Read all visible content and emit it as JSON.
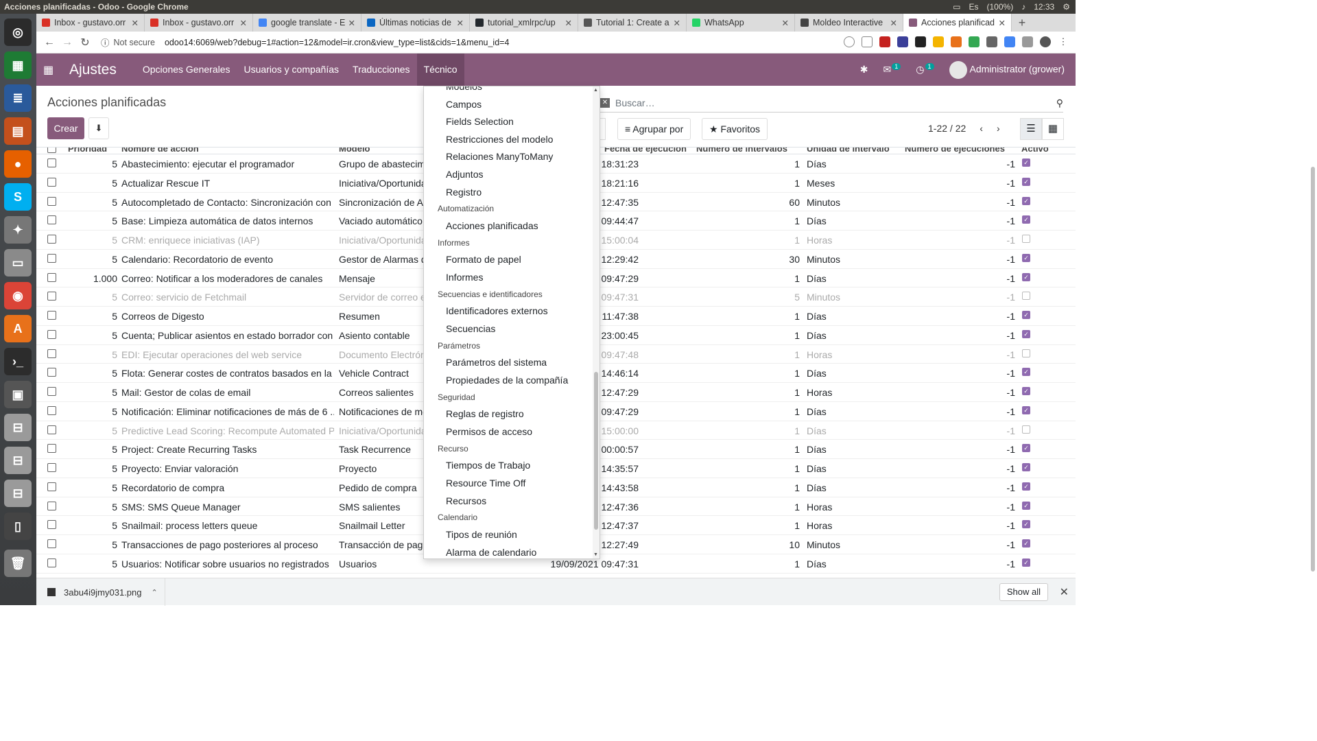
{
  "os": {
    "window_title": "Acciones planificadas - Odoo - Google Chrome",
    "battery": "(100%)",
    "time": "12:33",
    "kbd": "Es"
  },
  "chrome": {
    "tabs": [
      {
        "label": "Inbox - gustavo.orr",
        "color": "#d93025",
        "active": false
      },
      {
        "label": "Inbox - gustavo.orr",
        "color": "#d93025",
        "active": false
      },
      {
        "label": "google translate - E",
        "color": "#4285f4",
        "active": false
      },
      {
        "label": "Últimas noticias de",
        "color": "#0a66c2",
        "active": false
      },
      {
        "label": "tutorial_xmlrpc/up",
        "color": "#24292e",
        "active": false
      },
      {
        "label": "Tutorial 1: Create a",
        "color": "#555555",
        "active": false
      },
      {
        "label": "WhatsApp",
        "color": "#25d366",
        "active": false
      },
      {
        "label": "Moldeo Interactive",
        "color": "#444444",
        "active": false
      },
      {
        "label": "Acciones planificad",
        "color": "#875a7b",
        "active": true
      }
    ],
    "new_tab": "+",
    "not_secure": "Not secure",
    "url": "odoo14:6069/web?debug=1#action=12&model=ir.cron&view_type=list&cids=1&menu_id=4"
  },
  "odoo": {
    "brand": "Ajustes",
    "menus": [
      "Opciones Generales",
      "Usuarios y compañías",
      "Traducciones",
      "Técnico"
    ],
    "chat_badge": "1",
    "activity_badge": "1",
    "user": "Administrator (grower)",
    "title": "Acciones planificadas",
    "create": "Crear",
    "search_placeholder": "Buscar…",
    "group_by": "Agrupar por",
    "favorites": "Favoritos",
    "pager": "1-22 / 22",
    "accent": "#875a7b"
  },
  "table": {
    "headers": [
      "Prioridad",
      "Nombre de acción",
      "Modelo",
      "Fecha de ejecución",
      "Número de intervalos",
      "Unidad de intervalo",
      "Número de ejecuciones",
      "Activo"
    ],
    "rows": [
      {
        "prio": "5",
        "name": "Abastecimiento: ejecutar el programador",
        "model": "Grupo de abastecimi",
        "date": "18:31:23",
        "num": "1",
        "unit": "Días",
        "calls": "-1",
        "active": true
      },
      {
        "prio": "5",
        "name": "Actualizar Rescue IT",
        "model": "Iniciativa/Oportunidad",
        "date": "18:21:16",
        "num": "1",
        "unit": "Meses",
        "calls": "-1",
        "active": true
      },
      {
        "prio": "5",
        "name": "Autocompletado de Contacto: Sincronización con ...",
        "model": "Sincronización de Au",
        "date": "12:47:35",
        "num": "60",
        "unit": "Minutos",
        "calls": "-1",
        "active": true
      },
      {
        "prio": "5",
        "name": "Base: Limpieza automática de datos internos",
        "model": "Vaciado automático",
        "date": "09:44:47",
        "num": "1",
        "unit": "Días",
        "calls": "-1",
        "active": true
      },
      {
        "prio": "5",
        "name": "CRM: enriquece iniciativas (IAP)",
        "model": "Iniciativa/Oportunidad",
        "date": "15:00:04",
        "num": "1",
        "unit": "Horas",
        "calls": "-1",
        "active": false
      },
      {
        "prio": "5",
        "name": "Calendario: Recordatorio de evento",
        "model": "Gestor de Alarmas de",
        "date": "12:29:42",
        "num": "30",
        "unit": "Minutos",
        "calls": "-1",
        "active": true
      },
      {
        "prio": "1.000",
        "name": "Correo: Notificar a los moderadores de canales",
        "model": "Mensaje",
        "date": "09:47:29",
        "num": "1",
        "unit": "Días",
        "calls": "-1",
        "active": true
      },
      {
        "prio": "5",
        "name": "Correo: servicio de Fetchmail",
        "model": "Servidor de correo en",
        "date": "09:47:31",
        "num": "5",
        "unit": "Minutos",
        "calls": "-1",
        "active": false
      },
      {
        "prio": "5",
        "name": "Correos de Digesto",
        "model": "Resumen",
        "date": "11:47:38",
        "num": "1",
        "unit": "Días",
        "calls": "-1",
        "active": true
      },
      {
        "prio": "5",
        "name": "Cuenta; Publicar asientos en estado borrador con ...",
        "model": "Asiento contable",
        "date": "23:00:45",
        "num": "1",
        "unit": "Días",
        "calls": "-1",
        "active": true
      },
      {
        "prio": "5",
        "name": "EDI: Ejecutar operaciones del web service",
        "model": "Documento Electróni",
        "date": "09:47:48",
        "num": "1",
        "unit": "Horas",
        "calls": "-1",
        "active": false
      },
      {
        "prio": "5",
        "name": "Flota: Generar costes de contratos basados en la ...",
        "model": "Vehicle Contract",
        "date": "14:46:14",
        "num": "1",
        "unit": "Días",
        "calls": "-1",
        "active": true
      },
      {
        "prio": "5",
        "name": "Mail: Gestor de colas de email",
        "model": "Correos salientes",
        "date": "12:47:29",
        "num": "1",
        "unit": "Horas",
        "calls": "-1",
        "active": true
      },
      {
        "prio": "5",
        "name": "Notificación: Eliminar notificaciones de más de 6 ...",
        "model": "Notificaciones de me",
        "date": "09:47:29",
        "num": "1",
        "unit": "Días",
        "calls": "-1",
        "active": true
      },
      {
        "prio": "5",
        "name": "Predictive Lead Scoring: Recompute Automated P...",
        "model": "Iniciativa/Oportunidad",
        "date": "15:00:00",
        "num": "1",
        "unit": "Días",
        "calls": "-1",
        "active": false
      },
      {
        "prio": "5",
        "name": "Project: Create Recurring Tasks",
        "model": "Task Recurrence",
        "date": "00:00:57",
        "num": "1",
        "unit": "Días",
        "calls": "-1",
        "active": true
      },
      {
        "prio": "5",
        "name": "Proyecto: Enviar valoración",
        "model": "Proyecto",
        "date": "14:35:57",
        "num": "1",
        "unit": "Días",
        "calls": "-1",
        "active": true
      },
      {
        "prio": "5",
        "name": "Recordatorio de compra",
        "model": "Pedido de compra",
        "date": "14:43:58",
        "num": "1",
        "unit": "Días",
        "calls": "-1",
        "active": true
      },
      {
        "prio": "5",
        "name": "SMS: SMS Queue Manager",
        "model": "SMS salientes",
        "date": "12:47:36",
        "num": "1",
        "unit": "Horas",
        "calls": "-1",
        "active": true
      },
      {
        "prio": "5",
        "name": "Snailmail: process letters queue",
        "model": "Snailmail Letter",
        "date": "12:47:37",
        "num": "1",
        "unit": "Horas",
        "calls": "-1",
        "active": true
      },
      {
        "prio": "5",
        "name": "Transacciones de pago posteriores al proceso",
        "model": "Transacción de pago",
        "date": "12:27:49",
        "num": "10",
        "unit": "Minutos",
        "calls": "-1",
        "active": true
      },
      {
        "prio": "5",
        "name": "Usuarios: Notificar sobre usuarios no registrados",
        "model": "Usuarios",
        "date": "19/09/2021 09:47:31",
        "num": "1",
        "unit": "Días",
        "calls": "-1",
        "active": true
      }
    ]
  },
  "dropdown": [
    {
      "type": "item",
      "label": "Modelos"
    },
    {
      "type": "item",
      "label": "Campos"
    },
    {
      "type": "item",
      "label": "Fields Selection"
    },
    {
      "type": "item",
      "label": "Restricciones del modelo"
    },
    {
      "type": "item",
      "label": "Relaciones ManyToMany"
    },
    {
      "type": "item",
      "label": "Adjuntos"
    },
    {
      "type": "item",
      "label": "Registro"
    },
    {
      "type": "head",
      "label": "Automatización"
    },
    {
      "type": "item",
      "label": "Acciones planificadas"
    },
    {
      "type": "head",
      "label": "Informes"
    },
    {
      "type": "item",
      "label": "Formato de papel"
    },
    {
      "type": "item",
      "label": "Informes"
    },
    {
      "type": "head",
      "label": "Secuencias e identificadores"
    },
    {
      "type": "item",
      "label": "Identificadores externos"
    },
    {
      "type": "item",
      "label": "Secuencias"
    },
    {
      "type": "head",
      "label": "Parámetros"
    },
    {
      "type": "item",
      "label": "Parámetros del sistema"
    },
    {
      "type": "item",
      "label": "Propiedades de la compañía"
    },
    {
      "type": "head",
      "label": "Seguridad"
    },
    {
      "type": "item",
      "label": "Reglas de registro"
    },
    {
      "type": "item",
      "label": "Permisos de acceso"
    },
    {
      "type": "head",
      "label": "Recurso"
    },
    {
      "type": "item",
      "label": "Tiempos de Trabajo"
    },
    {
      "type": "item",
      "label": "Resource Time Off"
    },
    {
      "type": "item",
      "label": "Recursos"
    },
    {
      "type": "head",
      "label": "Calendario"
    },
    {
      "type": "item",
      "label": "Tipos de reunión"
    },
    {
      "type": "item",
      "label": "Alarma de calendario"
    }
  ],
  "downloads": {
    "file": "3abu4i9jmy031.png",
    "show_all": "Show all"
  }
}
